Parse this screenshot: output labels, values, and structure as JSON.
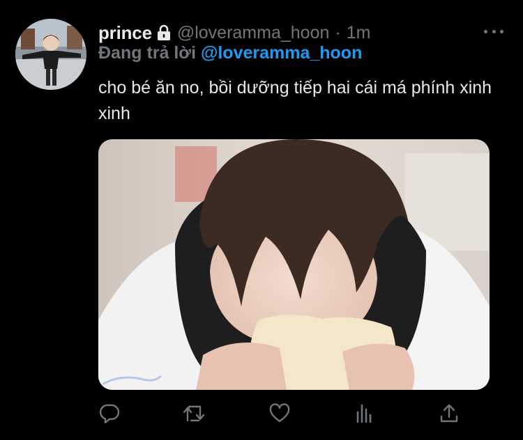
{
  "author": {
    "display_name": "prince",
    "handle": "@loveramma_hoon",
    "separator": "·",
    "timestamp": "1m",
    "protected_icon": "lock-icon"
  },
  "reply_context": {
    "prefix": "Đang trả lời",
    "mention": "@loveramma_hoon"
  },
  "tweet": {
    "text": "cho bé ăn no, bồi dưỡng tiếp hai cái má phính xinh xinh"
  },
  "media": {
    "type": "photo"
  },
  "actions": [
    "reply-icon",
    "retweet-icon",
    "like-icon",
    "analytics-icon",
    "share-icon"
  ],
  "colors": {
    "background": "#000000",
    "primary_text": "#e7e9ea",
    "secondary_text": "#71767b",
    "accent": "#1d9bf0"
  }
}
